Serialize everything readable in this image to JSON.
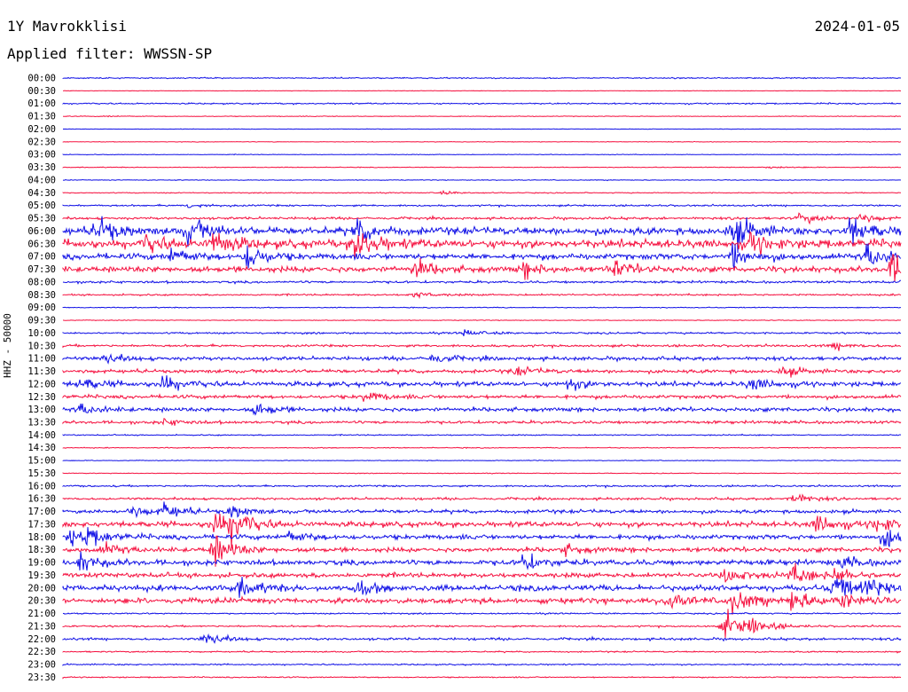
{
  "header": {
    "station": "1Y Mavrokklisi",
    "date": "2024-01-05",
    "filter": "Applied filter: WWSSN-SP"
  },
  "colors": {
    "blue": "#1010e6",
    "red": "#f5103f"
  },
  "chart_data": {
    "type": "line",
    "title": "1Y Mavrokklisi",
    "subtitle": "Applied filter: WWSSN-SP",
    "ylabel": "HHZ - 50000",
    "date": "2024-01-05",
    "line_interval_minutes": 30,
    "series_colors": [
      "#1010e6",
      "#f5103f"
    ],
    "x": [
      "00:00",
      "00:30",
      "01:00",
      "01:30",
      "02:00",
      "02:30",
      "03:00",
      "03:30",
      "04:00",
      "04:30",
      "05:00",
      "05:30",
      "06:00",
      "06:30",
      "07:00",
      "07:30",
      "08:00",
      "08:30",
      "09:00",
      "09:30",
      "10:00",
      "10:30",
      "11:00",
      "11:30",
      "12:00",
      "12:30",
      "13:00",
      "13:30",
      "14:00",
      "14:30",
      "15:00",
      "15:30",
      "16:00",
      "16:30",
      "17:00",
      "17:30",
      "18:00",
      "18:30",
      "19:00",
      "19:30",
      "20:00",
      "20:30",
      "21:00",
      "21:30",
      "22:00",
      "22:30",
      "23:00",
      "23:30"
    ],
    "activity": [
      1.0,
      0.4,
      1.2,
      0.6,
      0.4,
      0.5,
      0.6,
      0.6,
      0.6,
      0.8,
      1.5,
      2.0,
      6.0,
      7.0,
      5.0,
      5.0,
      2.0,
      1.5,
      0.8,
      0.6,
      1.5,
      2.0,
      3.0,
      3.0,
      4.0,
      3.0,
      3.5,
      2.5,
      1.0,
      0.8,
      0.6,
      0.6,
      1.5,
      2.0,
      3.0,
      4.5,
      4.0,
      4.0,
      4.5,
      4.0,
      5.0,
      4.5,
      1.2,
      1.5,
      2.0,
      1.2,
      1.2,
      1.0
    ],
    "events": [
      {
        "row": 3,
        "pos": 0.05,
        "amp": 1.0
      },
      {
        "row": 7,
        "pos": 0.84,
        "amp": 3.0
      },
      {
        "row": 9,
        "pos": 0.45,
        "amp": 3.0
      },
      {
        "row": 10,
        "pos": 0.15,
        "amp": 4.0
      },
      {
        "row": 11,
        "pos": 0.88,
        "amp": 10.0
      },
      {
        "row": 11,
        "pos": 0.95,
        "amp": 8.0
      },
      {
        "row": 12,
        "pos": 0.04,
        "amp": 26.0
      },
      {
        "row": 12,
        "pos": 0.15,
        "amp": 25.0
      },
      {
        "row": 12,
        "pos": 0.35,
        "amp": 22.0
      },
      {
        "row": 12,
        "pos": 0.8,
        "amp": 30.0
      },
      {
        "row": 12,
        "pos": 0.94,
        "amp": 28.0
      },
      {
        "row": 13,
        "pos": 0.1,
        "amp": 14.0
      },
      {
        "row": 13,
        "pos": 0.18,
        "amp": 22.0
      },
      {
        "row": 13,
        "pos": 0.35,
        "amp": 30.0
      },
      {
        "row": 13,
        "pos": 0.82,
        "amp": 18.0
      },
      {
        "row": 14,
        "pos": 0.13,
        "amp": 14.0
      },
      {
        "row": 14,
        "pos": 0.22,
        "amp": 22.0
      },
      {
        "row": 14,
        "pos": 0.8,
        "amp": 18.0
      },
      {
        "row": 14,
        "pos": 0.96,
        "amp": 22.0
      },
      {
        "row": 15,
        "pos": 0.42,
        "amp": 16.0
      },
      {
        "row": 15,
        "pos": 0.55,
        "amp": 12.0
      },
      {
        "row": 15,
        "pos": 0.66,
        "amp": 14.0
      },
      {
        "row": 15,
        "pos": 0.99,
        "amp": 30.0
      },
      {
        "row": 17,
        "pos": 0.42,
        "amp": 5.0
      },
      {
        "row": 20,
        "pos": 0.48,
        "amp": 6.0
      },
      {
        "row": 21,
        "pos": 0.92,
        "amp": 7.0
      },
      {
        "row": 22,
        "pos": 0.05,
        "amp": 9.0
      },
      {
        "row": 22,
        "pos": 0.44,
        "amp": 9.0
      },
      {
        "row": 23,
        "pos": 0.54,
        "amp": 8.0
      },
      {
        "row": 23,
        "pos": 0.86,
        "amp": 8.0
      },
      {
        "row": 24,
        "pos": 0.02,
        "amp": 12.0
      },
      {
        "row": 24,
        "pos": 0.12,
        "amp": 14.0
      },
      {
        "row": 24,
        "pos": 0.6,
        "amp": 12.0
      },
      {
        "row": 24,
        "pos": 0.82,
        "amp": 12.0
      },
      {
        "row": 25,
        "pos": 0.36,
        "amp": 10.0
      },
      {
        "row": 26,
        "pos": 0.02,
        "amp": 10.0
      },
      {
        "row": 26,
        "pos": 0.23,
        "amp": 12.0
      },
      {
        "row": 27,
        "pos": 0.12,
        "amp": 6.0
      },
      {
        "row": 33,
        "pos": 0.87,
        "amp": 10.0
      },
      {
        "row": 34,
        "pos": 0.08,
        "amp": 10.0
      },
      {
        "row": 34,
        "pos": 0.12,
        "amp": 16.0
      },
      {
        "row": 34,
        "pos": 0.2,
        "amp": 12.0
      },
      {
        "row": 35,
        "pos": 0.18,
        "amp": 20.0
      },
      {
        "row": 35,
        "pos": 0.2,
        "amp": 30.0
      },
      {
        "row": 35,
        "pos": 0.9,
        "amp": 16.0
      },
      {
        "row": 35,
        "pos": 0.97,
        "amp": 14.0
      },
      {
        "row": 36,
        "pos": 0.01,
        "amp": 14.0
      },
      {
        "row": 36,
        "pos": 0.03,
        "amp": 14.0
      },
      {
        "row": 36,
        "pos": 0.27,
        "amp": 10.0
      },
      {
        "row": 36,
        "pos": 0.98,
        "amp": 18.0
      },
      {
        "row": 37,
        "pos": 0.05,
        "amp": 10.0
      },
      {
        "row": 37,
        "pos": 0.18,
        "amp": 30.0
      },
      {
        "row": 37,
        "pos": 0.6,
        "amp": 8.0
      },
      {
        "row": 38,
        "pos": 0.02,
        "amp": 18.0
      },
      {
        "row": 38,
        "pos": 0.55,
        "amp": 16.0
      },
      {
        "row": 38,
        "pos": 0.93,
        "amp": 10.0
      },
      {
        "row": 39,
        "pos": 0.79,
        "amp": 16.0
      },
      {
        "row": 39,
        "pos": 0.87,
        "amp": 18.0
      },
      {
        "row": 39,
        "pos": 0.92,
        "amp": 14.0
      },
      {
        "row": 40,
        "pos": 0.21,
        "amp": 14.0
      },
      {
        "row": 40,
        "pos": 0.35,
        "amp": 12.0
      },
      {
        "row": 40,
        "pos": 0.92,
        "amp": 22.0
      },
      {
        "row": 40,
        "pos": 0.96,
        "amp": 16.0
      },
      {
        "row": 41,
        "pos": 0.72,
        "amp": 16.0
      },
      {
        "row": 41,
        "pos": 0.8,
        "amp": 22.0
      },
      {
        "row": 41,
        "pos": 0.87,
        "amp": 20.0
      },
      {
        "row": 41,
        "pos": 0.93,
        "amp": 12.0
      },
      {
        "row": 43,
        "pos": 0.79,
        "amp": 24.0
      },
      {
        "row": 43,
        "pos": 0.82,
        "amp": 14.0
      },
      {
        "row": 44,
        "pos": 0.17,
        "amp": 12.0
      }
    ]
  }
}
